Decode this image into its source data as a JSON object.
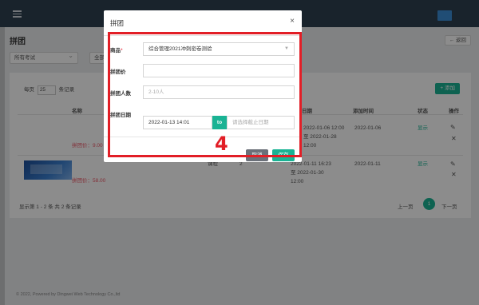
{
  "page": {
    "title": "拼团",
    "back_label": "← 返回"
  },
  "filters": {
    "exam": "所有考试",
    "type": "全部"
  },
  "list": {
    "per_page_prefix": "每页",
    "per_page_value": "25",
    "per_page_suffix": "条记录",
    "add_label": "+ 添加",
    "headers": {
      "name": "名称",
      "date": "日期",
      "added": "添加时间",
      "status": "状态",
      "ops": "操作"
    },
    "rows": [
      {
        "price": "拼团价：9.00",
        "start": "2022-01-06 12:00",
        "to_end": "至 2022-01-28",
        "time": "12:00",
        "added": "2022-01-06",
        "status": "显示"
      },
      {
        "price": "拼团价：58.00",
        "type": "课程",
        "count": "2",
        "start": "2022-01-11 16:23",
        "to_end": "至 2022-01-30",
        "time": "12:00",
        "added": "2022-01-11",
        "status": "显示"
      }
    ],
    "summary": "显示第 1 - 2 条   共 2 条记录",
    "pager": {
      "prev": "上一页",
      "current": "1",
      "next": "下一页"
    }
  },
  "footer": "© 2022, Powered by Dingwei Web Technology Co.,ltd",
  "modal": {
    "title": "拼团",
    "close": "×",
    "fields": {
      "product_label": "商品",
      "product_required": "*",
      "product_value": "综合管理2021冲刺密卷测验",
      "price_label": "拼团价",
      "price_value": "",
      "count_label": "拼团人数",
      "count_placeholder": "2-10人",
      "date_label": "拼团日期",
      "date_start": "2022-01-13 14:01",
      "date_to": "to",
      "date_end_placeholder": "请选择截止日期"
    },
    "cancel_label": "取消",
    "save_label": "保存"
  },
  "annotation": {
    "step": "4",
    "color": "#e21e26"
  },
  "colors": {
    "accent": "#1ab394",
    "topbar": "#2f4050"
  }
}
